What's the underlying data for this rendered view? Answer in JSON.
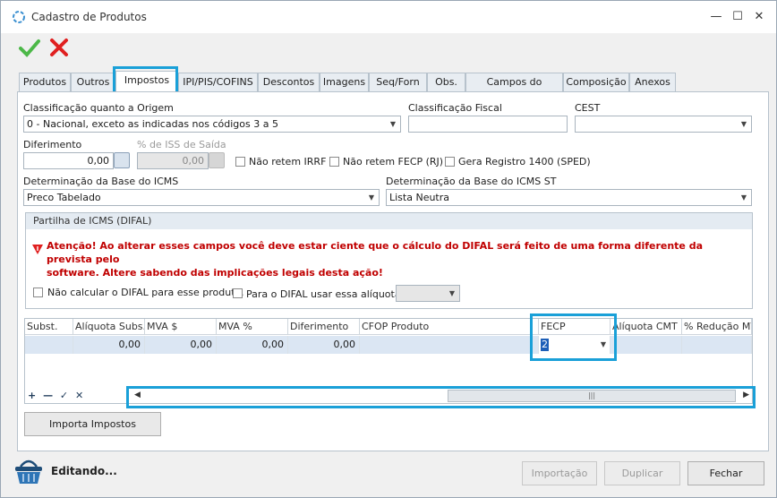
{
  "window": {
    "title": "Cadastro de Produtos",
    "min_symbol": "—",
    "max_symbol": "☐",
    "close_symbol": "✕"
  },
  "toolbar": {
    "confirm_icon": "check-icon",
    "cancel_icon": "close-icon",
    "colors": {
      "confirm": "#4cb848",
      "cancel": "#e02020"
    }
  },
  "tabs": [
    "Produtos",
    "Outros",
    "Impostos",
    "IPI/PIS/COFINS",
    "Descontos",
    "Imagens",
    "Seq/Forn",
    "Obs.",
    "Campos do Usuário",
    "Composição",
    "Anexos"
  ],
  "active_tab": "Impostos",
  "form": {
    "origem_label": "Classificação quanto a Origem",
    "origem_value": "0 - Nacional, exceto as indicadas nos códigos 3 a 5",
    "fiscal_label": "Classificação Fiscal",
    "fiscal_value": "",
    "cest_label": "CEST",
    "cest_value": "",
    "diferimento_label": "Diferimento",
    "diferimento_value": "0,00",
    "iss_label": "% de ISS de Saída",
    "iss_value": "0,00",
    "nao_retem_irrf": "Não retem IRRF",
    "nao_retem_fecp": "Não retem FECP (RJ)",
    "gera_registro": "Gera Registro 1400 (SPED)",
    "base_icms_label": "Determinação da Base do ICMS",
    "base_icms_value": "Preco Tabelado",
    "base_icms_st_label": "Determinação da Base do ICMS ST",
    "base_icms_st_value": "Lista Neutra"
  },
  "difal": {
    "title": "Partilha de ICMS (DIFAL)",
    "warning_line1": "Atenção! Ao alterar esses campos você deve estar ciente que o cálculo do DIFAL será feito de uma forma diferente da prevista pelo",
    "warning_line2": "software. Altere sabendo das implicações legais desta ação!",
    "nao_calcular": "Não calcular o DIFAL para esse produto.",
    "usar_aliquota": "Para o DIFAL usar essa alíquota:",
    "aliquota_value": ""
  },
  "grid": {
    "columns": [
      "Subst.",
      "Alíquota Subs. T",
      "MVA $",
      "MVA %",
      "Diferimento",
      "CFOP Produto",
      "FECP",
      "Alíquota CMT",
      "% Redução MVA"
    ],
    "row": [
      "",
      "0,00",
      "0,00",
      "0,00",
      "0,00",
      "",
      "2",
      "",
      ""
    ],
    "nav": "+̣ — ✓ ✕",
    "scroll_left": "◀",
    "scroll_right": "▶",
    "scroll_thumb": "|||"
  },
  "buttons": {
    "importa_impostos": "Importa Impostos",
    "importacao": "Importação",
    "duplicar": "Duplicar",
    "fechar": "Fechar"
  },
  "status": {
    "text": "Editando..."
  },
  "colors": {
    "highlight": "#1aa0d8",
    "warning": "#c00000"
  }
}
